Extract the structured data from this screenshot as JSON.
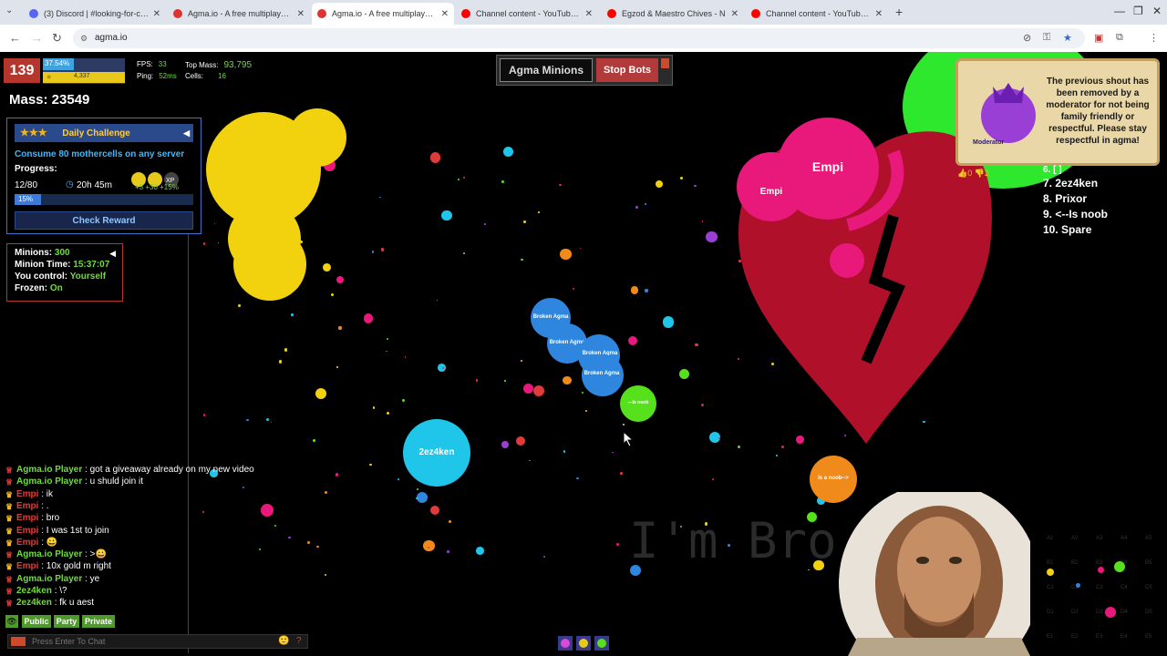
{
  "browser": {
    "tabs": [
      {
        "label": "(3) Discord | #looking-for-clan",
        "icon_color": "#5865f2",
        "active": false
      },
      {
        "label": "Agma.io - A free multiplayer M",
        "icon_color": "#d33",
        "active": false
      },
      {
        "label": "Agma.io - A free multiplayer M",
        "icon_color": "#d33",
        "active": true
      },
      {
        "label": "Channel content - YouTube Stu",
        "icon_color": "#f00",
        "active": false
      },
      {
        "label": "Egzod & Maestro Chives - N",
        "icon_color": "#f00",
        "active": false
      },
      {
        "label": "Channel content - YouTube Stu",
        "icon_color": "#f00",
        "active": false
      }
    ],
    "url": "agma.io"
  },
  "hud": {
    "level": "139",
    "xp_pct": "37.54%",
    "xp_fraction": 0.3754,
    "coins": "4,337",
    "fps_label": "FPS:",
    "fps": "33",
    "ping_label": "Ping:",
    "ping": "52ms",
    "top_mass_label": "Top Mass:",
    "top_mass": "93,795",
    "cells_label": "Cells:",
    "cells": "16",
    "mass": "Mass: 23549"
  },
  "challenge": {
    "title": "Daily Challenge",
    "stars": "★★★",
    "description": "Consume 80 mothercells on any server",
    "progress_label": "Progress:",
    "count": "12/80",
    "time_left": "20h 45m",
    "bonus": "+3 +30 +15%",
    "progress_pct": "15%",
    "progress_fraction": 0.15,
    "check_reward": "Check Reward"
  },
  "minions": {
    "rows": [
      {
        "label": "Minions: ",
        "value": "300"
      },
      {
        "label": "Minion Time: ",
        "value": "15:37:07"
      },
      {
        "label": "You control: ",
        "value": "Yourself"
      },
      {
        "label": "Frozen: ",
        "value": "On"
      }
    ]
  },
  "top_panel": {
    "agma_minions": "Agma Minions",
    "stop_bots": "Stop Bots"
  },
  "moderator_notice": {
    "badge_label": "Moderator",
    "text": "The previous shout has been removed by a moderator for not being family friendly or respectful. Please stay respectful in agma!",
    "votes": "👍0  👎2"
  },
  "leaderboard": [
    "6. [  ]",
    "7. 2ez4ken",
    "8. Prixor",
    "9. <--Is noob",
    "10. Spare"
  ],
  "cells": {
    "empi_main": "Empi",
    "empi_small": "Empi",
    "ez4ken": "2ez4ken",
    "noob": "Is a noob-->",
    "bots": [
      "Broken Agma",
      "Broken Agma",
      "Broken Agma",
      "Broken Agma"
    ],
    "green_small": "---Is noob"
  },
  "chat": [
    {
      "name": "Agma.io Player",
      "msg": ": got a giveaway already on my new video",
      "empi": false
    },
    {
      "name": "Agma.io Player",
      "msg": ": u shuld join it",
      "empi": false
    },
    {
      "name": "Empi",
      "msg": ": ik",
      "empi": true
    },
    {
      "name": "Empi",
      "msg": ": .",
      "empi": true
    },
    {
      "name": "Empi",
      "msg": ": bro",
      "empi": true
    },
    {
      "name": "Empi",
      "msg": ": I was 1st to join",
      "empi": true
    },
    {
      "name": "Empi",
      "msg": ": 😀",
      "empi": true
    },
    {
      "name": "Agma.io Player",
      "msg": ": >😀",
      "empi": false
    },
    {
      "name": "Empi",
      "msg": ": 10x gold m right",
      "empi": true
    },
    {
      "name": "Agma.io Player",
      "msg": ": ye",
      "empi": false
    },
    {
      "name": "2ez4ken",
      "msg": ": \\?",
      "empi": false
    },
    {
      "name": "2ez4ken",
      "msg": ": fk u aest",
      "empi": false
    }
  ],
  "chat_tabs": [
    "Public",
    "Party",
    "Private"
  ],
  "chat_placeholder": "Press Enter To Chat",
  "watermark": "I'm Bro",
  "minimap": [
    "A1",
    "A2",
    "A3",
    "A4",
    "A5",
    "B1",
    "B2",
    "B3",
    "B4",
    "B5",
    "C1",
    "C2",
    "C3",
    "C4",
    "C5",
    "D1",
    "D2",
    "D3",
    "D4",
    "D5",
    "E1",
    "E2",
    "E3",
    "E4",
    "E5"
  ],
  "colors": {
    "level_red": "#b5362c",
    "chat_green": "#6fdc3c",
    "empi_pink": "#e8197a",
    "ez4ken_cyan": "#1fc6ea",
    "bot_blue": "#2e86de"
  }
}
